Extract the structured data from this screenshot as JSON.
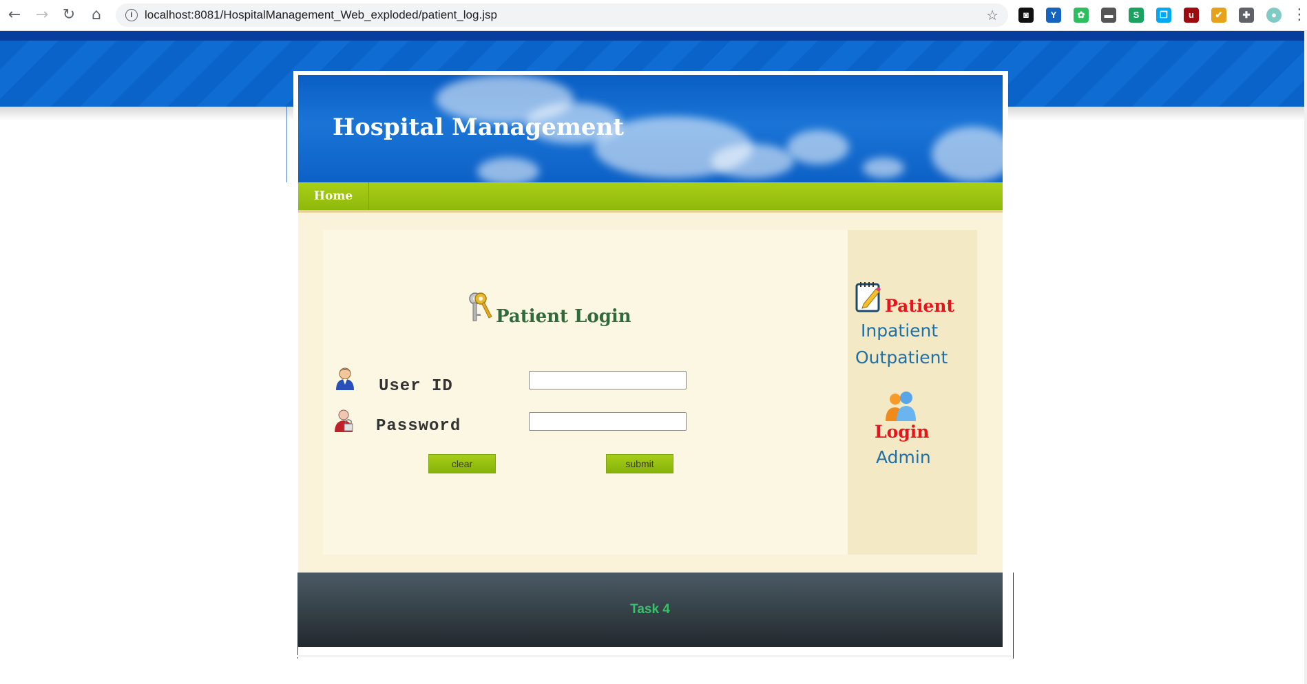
{
  "browser": {
    "url": "localhost:8081/HospitalManagement_Web_exploded/patient_log.jsp",
    "extensions": [
      {
        "name": "ext-incognito-icon",
        "color": "#111111",
        "glyph": "◙"
      },
      {
        "name": "ext-y-icon",
        "color": "#1565c0",
        "glyph": "Y"
      },
      {
        "name": "ext-evernote-icon",
        "color": "#2dbe60",
        "glyph": "✿"
      },
      {
        "name": "ext-car-icon",
        "color": "#555555",
        "glyph": "▬"
      },
      {
        "name": "ext-s-icon",
        "color": "#1aa260",
        "glyph": "S"
      },
      {
        "name": "ext-copy-icon",
        "color": "#03a9f4",
        "glyph": "❐"
      },
      {
        "name": "ext-ublock-icon",
        "color": "#9e0b0f",
        "glyph": "u"
      },
      {
        "name": "ext-chrome-icon",
        "color": "#e8a21a",
        "glyph": "✔"
      },
      {
        "name": "extensions-puzzle-icon",
        "color": "#5f6368",
        "glyph": "✚"
      },
      {
        "name": "profile-avatar-icon",
        "color": "#80cbc4",
        "glyph": "●"
      }
    ]
  },
  "header": {
    "title": "Hospital Management"
  },
  "menu": {
    "home": "Home"
  },
  "login": {
    "title": "Patient Login",
    "user_label": "User ID",
    "password_label": "Password",
    "user_value": "",
    "password_value": "",
    "clear_label": "clear",
    "submit_label": "submit"
  },
  "sidebar": {
    "patient": "Patient",
    "inpatient": "Inpatient",
    "outpatient": "Outpatient",
    "login": "Login",
    "admin": "Admin"
  },
  "footer": {
    "text": "Task 4"
  },
  "colors": {
    "accent_green": "#9fc510",
    "header_blue": "#0a5ec4",
    "sidebar_red": "#e8141c",
    "sidebar_blue": "#1f6fa8",
    "footer_text": "#39c06a"
  }
}
